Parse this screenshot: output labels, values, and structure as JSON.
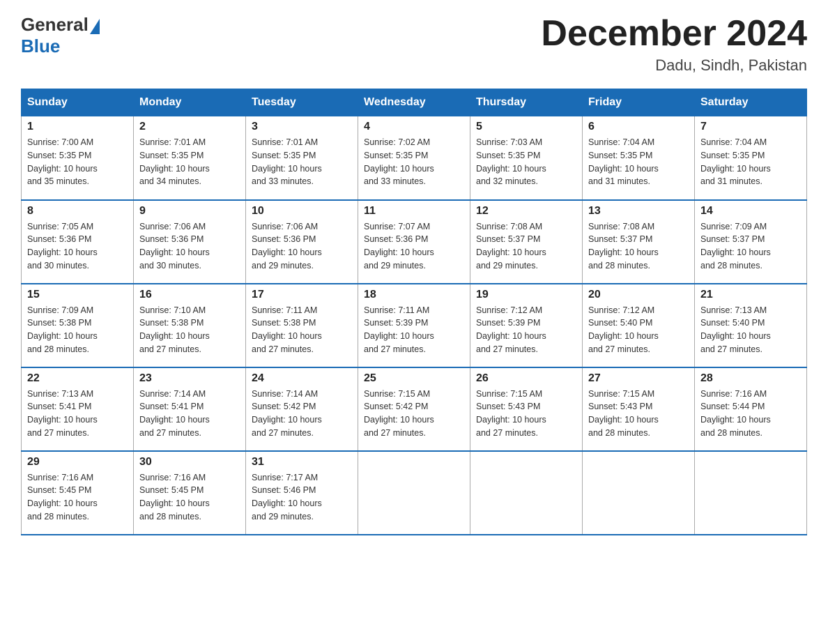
{
  "header": {
    "logo_general": "General",
    "logo_blue": "Blue",
    "title": "December 2024",
    "subtitle": "Dadu, Sindh, Pakistan"
  },
  "weekdays": [
    "Sunday",
    "Monday",
    "Tuesday",
    "Wednesday",
    "Thursday",
    "Friday",
    "Saturday"
  ],
  "weeks": [
    [
      {
        "day": "1",
        "sunrise": "7:00 AM",
        "sunset": "5:35 PM",
        "daylight": "10 hours and 35 minutes."
      },
      {
        "day": "2",
        "sunrise": "7:01 AM",
        "sunset": "5:35 PM",
        "daylight": "10 hours and 34 minutes."
      },
      {
        "day": "3",
        "sunrise": "7:01 AM",
        "sunset": "5:35 PM",
        "daylight": "10 hours and 33 minutes."
      },
      {
        "day": "4",
        "sunrise": "7:02 AM",
        "sunset": "5:35 PM",
        "daylight": "10 hours and 33 minutes."
      },
      {
        "day": "5",
        "sunrise": "7:03 AM",
        "sunset": "5:35 PM",
        "daylight": "10 hours and 32 minutes."
      },
      {
        "day": "6",
        "sunrise": "7:04 AM",
        "sunset": "5:35 PM",
        "daylight": "10 hours and 31 minutes."
      },
      {
        "day": "7",
        "sunrise": "7:04 AM",
        "sunset": "5:35 PM",
        "daylight": "10 hours and 31 minutes."
      }
    ],
    [
      {
        "day": "8",
        "sunrise": "7:05 AM",
        "sunset": "5:36 PM",
        "daylight": "10 hours and 30 minutes."
      },
      {
        "day": "9",
        "sunrise": "7:06 AM",
        "sunset": "5:36 PM",
        "daylight": "10 hours and 30 minutes."
      },
      {
        "day": "10",
        "sunrise": "7:06 AM",
        "sunset": "5:36 PM",
        "daylight": "10 hours and 29 minutes."
      },
      {
        "day": "11",
        "sunrise": "7:07 AM",
        "sunset": "5:36 PM",
        "daylight": "10 hours and 29 minutes."
      },
      {
        "day": "12",
        "sunrise": "7:08 AM",
        "sunset": "5:37 PM",
        "daylight": "10 hours and 29 minutes."
      },
      {
        "day": "13",
        "sunrise": "7:08 AM",
        "sunset": "5:37 PM",
        "daylight": "10 hours and 28 minutes."
      },
      {
        "day": "14",
        "sunrise": "7:09 AM",
        "sunset": "5:37 PM",
        "daylight": "10 hours and 28 minutes."
      }
    ],
    [
      {
        "day": "15",
        "sunrise": "7:09 AM",
        "sunset": "5:38 PM",
        "daylight": "10 hours and 28 minutes."
      },
      {
        "day": "16",
        "sunrise": "7:10 AM",
        "sunset": "5:38 PM",
        "daylight": "10 hours and 27 minutes."
      },
      {
        "day": "17",
        "sunrise": "7:11 AM",
        "sunset": "5:38 PM",
        "daylight": "10 hours and 27 minutes."
      },
      {
        "day": "18",
        "sunrise": "7:11 AM",
        "sunset": "5:39 PM",
        "daylight": "10 hours and 27 minutes."
      },
      {
        "day": "19",
        "sunrise": "7:12 AM",
        "sunset": "5:39 PM",
        "daylight": "10 hours and 27 minutes."
      },
      {
        "day": "20",
        "sunrise": "7:12 AM",
        "sunset": "5:40 PM",
        "daylight": "10 hours and 27 minutes."
      },
      {
        "day": "21",
        "sunrise": "7:13 AM",
        "sunset": "5:40 PM",
        "daylight": "10 hours and 27 minutes."
      }
    ],
    [
      {
        "day": "22",
        "sunrise": "7:13 AM",
        "sunset": "5:41 PM",
        "daylight": "10 hours and 27 minutes."
      },
      {
        "day": "23",
        "sunrise": "7:14 AM",
        "sunset": "5:41 PM",
        "daylight": "10 hours and 27 minutes."
      },
      {
        "day": "24",
        "sunrise": "7:14 AM",
        "sunset": "5:42 PM",
        "daylight": "10 hours and 27 minutes."
      },
      {
        "day": "25",
        "sunrise": "7:15 AM",
        "sunset": "5:42 PM",
        "daylight": "10 hours and 27 minutes."
      },
      {
        "day": "26",
        "sunrise": "7:15 AM",
        "sunset": "5:43 PM",
        "daylight": "10 hours and 27 minutes."
      },
      {
        "day": "27",
        "sunrise": "7:15 AM",
        "sunset": "5:43 PM",
        "daylight": "10 hours and 28 minutes."
      },
      {
        "day": "28",
        "sunrise": "7:16 AM",
        "sunset": "5:44 PM",
        "daylight": "10 hours and 28 minutes."
      }
    ],
    [
      {
        "day": "29",
        "sunrise": "7:16 AM",
        "sunset": "5:45 PM",
        "daylight": "10 hours and 28 minutes."
      },
      {
        "day": "30",
        "sunrise": "7:16 AM",
        "sunset": "5:45 PM",
        "daylight": "10 hours and 28 minutes."
      },
      {
        "day": "31",
        "sunrise": "7:17 AM",
        "sunset": "5:46 PM",
        "daylight": "10 hours and 29 minutes."
      },
      null,
      null,
      null,
      null
    ]
  ],
  "labels": {
    "sunrise": "Sunrise:",
    "sunset": "Sunset:",
    "daylight": "Daylight:"
  }
}
